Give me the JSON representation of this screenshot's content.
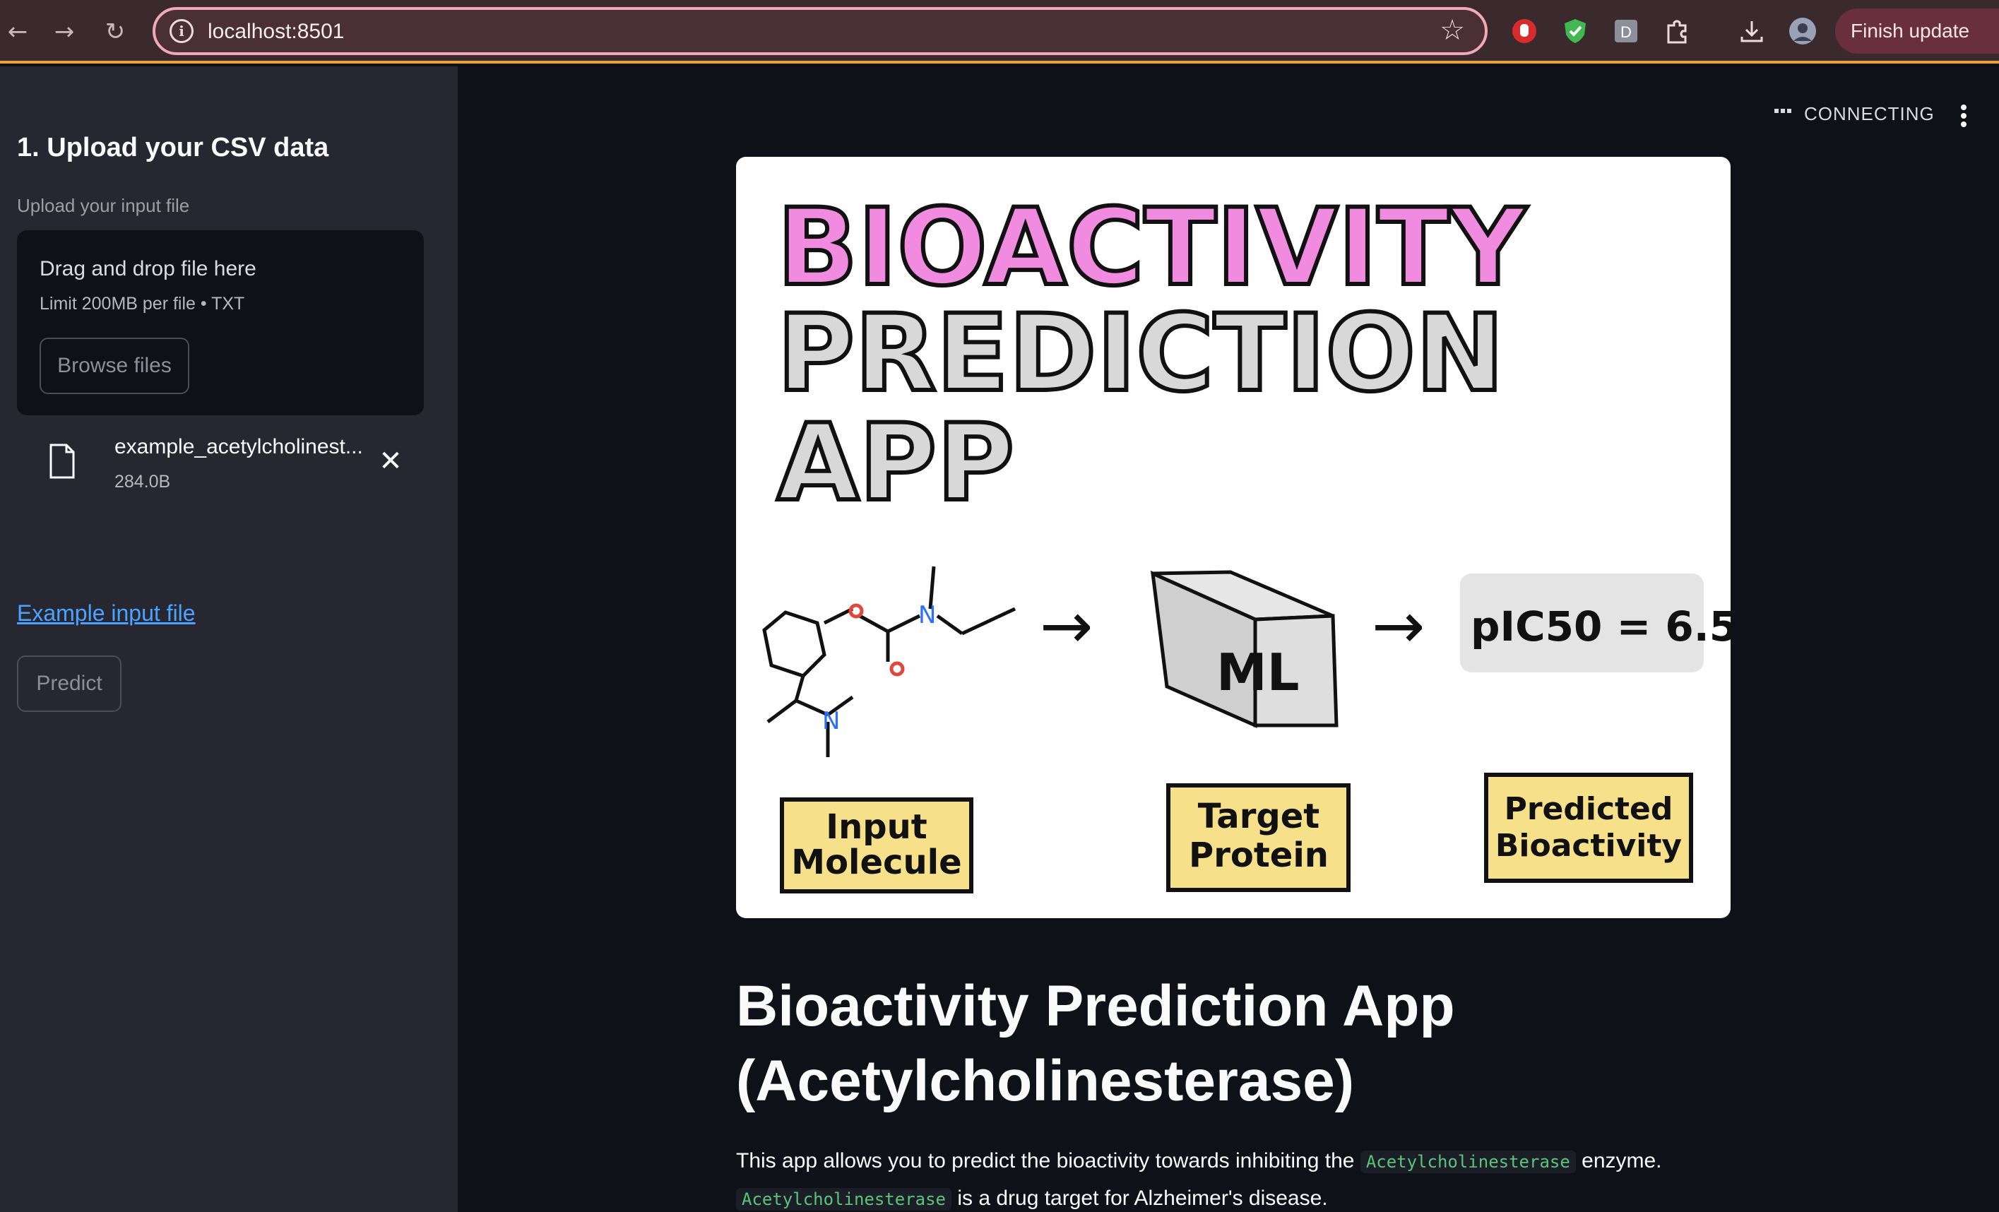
{
  "browser": {
    "url": "localhost:8501",
    "finish_update_label": "Finish update",
    "extension_icons": [
      "stop-hand-icon",
      "shield-check-icon",
      "d-extension-icon",
      "puzzle-icon",
      "download-icon",
      "profile-icon"
    ]
  },
  "sidebar": {
    "heading": "1. Upload your CSV data",
    "upload_label": "Upload your input file",
    "dropzone_title": "Drag and drop file here",
    "dropzone_limit": "Limit 200MB per file • TXT",
    "browse_label": "Browse files",
    "file": {
      "name": "example_acetylcholinest...",
      "size": "284.0B"
    },
    "example_link": "Example input file",
    "predict_label": "Predict"
  },
  "main": {
    "status": "CONNECTING",
    "banner": {
      "line1": "BIOACTIVITY",
      "line2": "PREDICTION",
      "line3": "APP",
      "ml_label": "ML",
      "pic50_label": "pIC50 = 6.5",
      "box1_line1": "Input",
      "box1_line2": "Molecule",
      "box2_line1": "Target",
      "box2_line2": "Protein",
      "box3_line1": "Predicted",
      "box3_line2": "Bioactivity"
    },
    "title_line1": "Bioactivity Prediction App",
    "title_line2": "(Acetylcholinesterase)",
    "desc_part1": "This app allows you to predict the bioactivity towards inhibiting the",
    "desc_code": "Acetylcholinesterase",
    "desc_part2": "enzyme.",
    "desc2_code": "Acetylcholinesterase",
    "desc2_part": "is a drug target for Alzheimer's disease."
  },
  "colors": {
    "accent_link": "#4aa3ff",
    "sidebar_bg": "#262730",
    "main_bg": "#0e1117",
    "code_green": "#5ac57a",
    "banner_pink": "#f08be0",
    "banner_yellow": "#f7e08a"
  }
}
